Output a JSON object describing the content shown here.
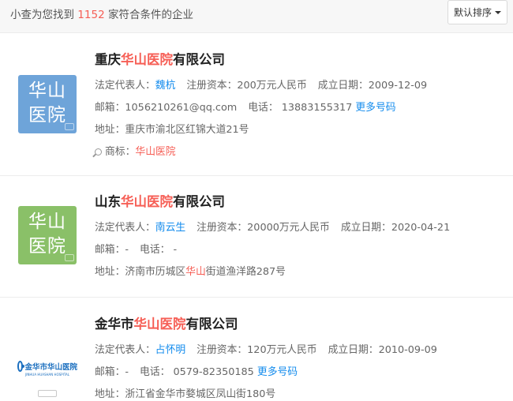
{
  "summary": {
    "prefix": "小查为您找到",
    "count": "1152",
    "suffix": "家符合条件的企业"
  },
  "sort": {
    "label": "默认排序"
  },
  "labels": {
    "legal_rep": "法定代表人：",
    "capital": "注册资本：",
    "established": "成立日期：",
    "email": "邮箱：",
    "phone": "电话：",
    "address": "地址：",
    "trademark": "商标：",
    "more_numbers": "更多号码"
  },
  "companies": [
    {
      "name_pre": "重庆",
      "name_hl": "华山医院",
      "name_post": "有限公司",
      "logo_text_1": "华山",
      "logo_text_2": "医院",
      "legal_rep": "魏杭",
      "capital": "200万元人民币",
      "established": "2009-12-09",
      "email": "1056210261@qq.com",
      "phone": "13883155317",
      "address_pre": "重庆市渝北区红锦大道21号",
      "trademark": "华山医院"
    },
    {
      "name_pre": "山东",
      "name_hl": "华山医院",
      "name_post": "有限公司",
      "logo_text_1": "华山",
      "logo_text_2": "医院",
      "legal_rep": "南云生",
      "capital": "20000万元人民币",
      "established": "2020-04-21",
      "email": "-",
      "phone": "-",
      "address_pre": "济南市历城区",
      "address_hl": "华山",
      "address_post": "街道渔洋路287号"
    },
    {
      "name_pre": "金华市",
      "name_hl": "华山医院",
      "name_post": "有限公司",
      "logo_text_1": "金华市华山医院",
      "logo_text_2": "JINHUA HUASHAN HOSPITAL",
      "legal_rep": "占怀明",
      "capital": "120万元人民币",
      "established": "2010-09-09",
      "email": "-",
      "phone": "0579-82350185",
      "address_pre": "浙江省金华市婺城区凤山街180号"
    }
  ]
}
